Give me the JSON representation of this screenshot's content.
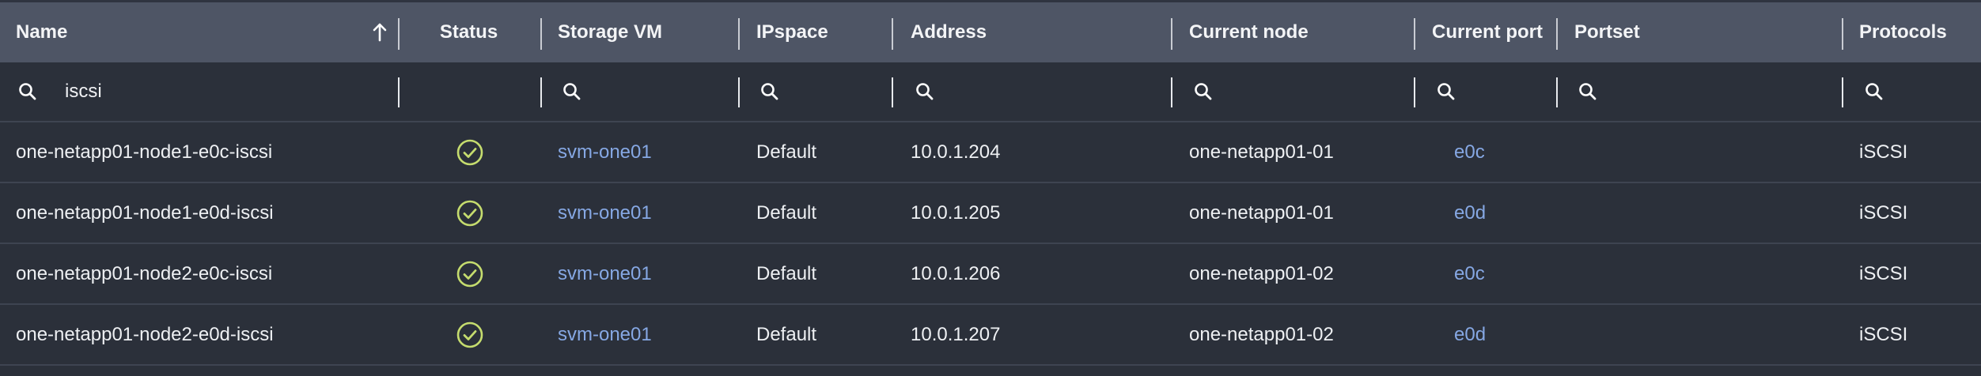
{
  "columns": {
    "name": "Name",
    "status": "Status",
    "storage_vm": "Storage VM",
    "ipspace": "IPspace",
    "address": "Address",
    "current_node": "Current node",
    "current_port": "Current port",
    "portset": "Portset",
    "protocols": "Protocols"
  },
  "filters": {
    "name_value": "iscsi"
  },
  "colors": {
    "header_bg": "#4e5565",
    "body_bg": "#2b303a",
    "link": "#86a8e4",
    "status_ok": "#c5dc6e"
  },
  "rows": [
    {
      "name": "one-netapp01-node1-e0c-iscsi",
      "status": "ok",
      "storage_vm": "svm-one01",
      "ipspace": "Default",
      "address": "10.0.1.204",
      "current_node": "one-netapp01-01",
      "current_port": "e0c",
      "portset": "",
      "protocols": "iSCSI"
    },
    {
      "name": "one-netapp01-node1-e0d-iscsi",
      "status": "ok",
      "storage_vm": "svm-one01",
      "ipspace": "Default",
      "address": "10.0.1.205",
      "current_node": "one-netapp01-01",
      "current_port": "e0d",
      "portset": "",
      "protocols": "iSCSI"
    },
    {
      "name": "one-netapp01-node2-e0c-iscsi",
      "status": "ok",
      "storage_vm": "svm-one01",
      "ipspace": "Default",
      "address": "10.0.1.206",
      "current_node": "one-netapp01-02",
      "current_port": "e0c",
      "portset": "",
      "protocols": "iSCSI"
    },
    {
      "name": "one-netapp01-node2-e0d-iscsi",
      "status": "ok",
      "storage_vm": "svm-one01",
      "ipspace": "Default",
      "address": "10.0.1.207",
      "current_node": "one-netapp01-02",
      "current_port": "e0d",
      "portset": "",
      "protocols": "iSCSI"
    }
  ]
}
